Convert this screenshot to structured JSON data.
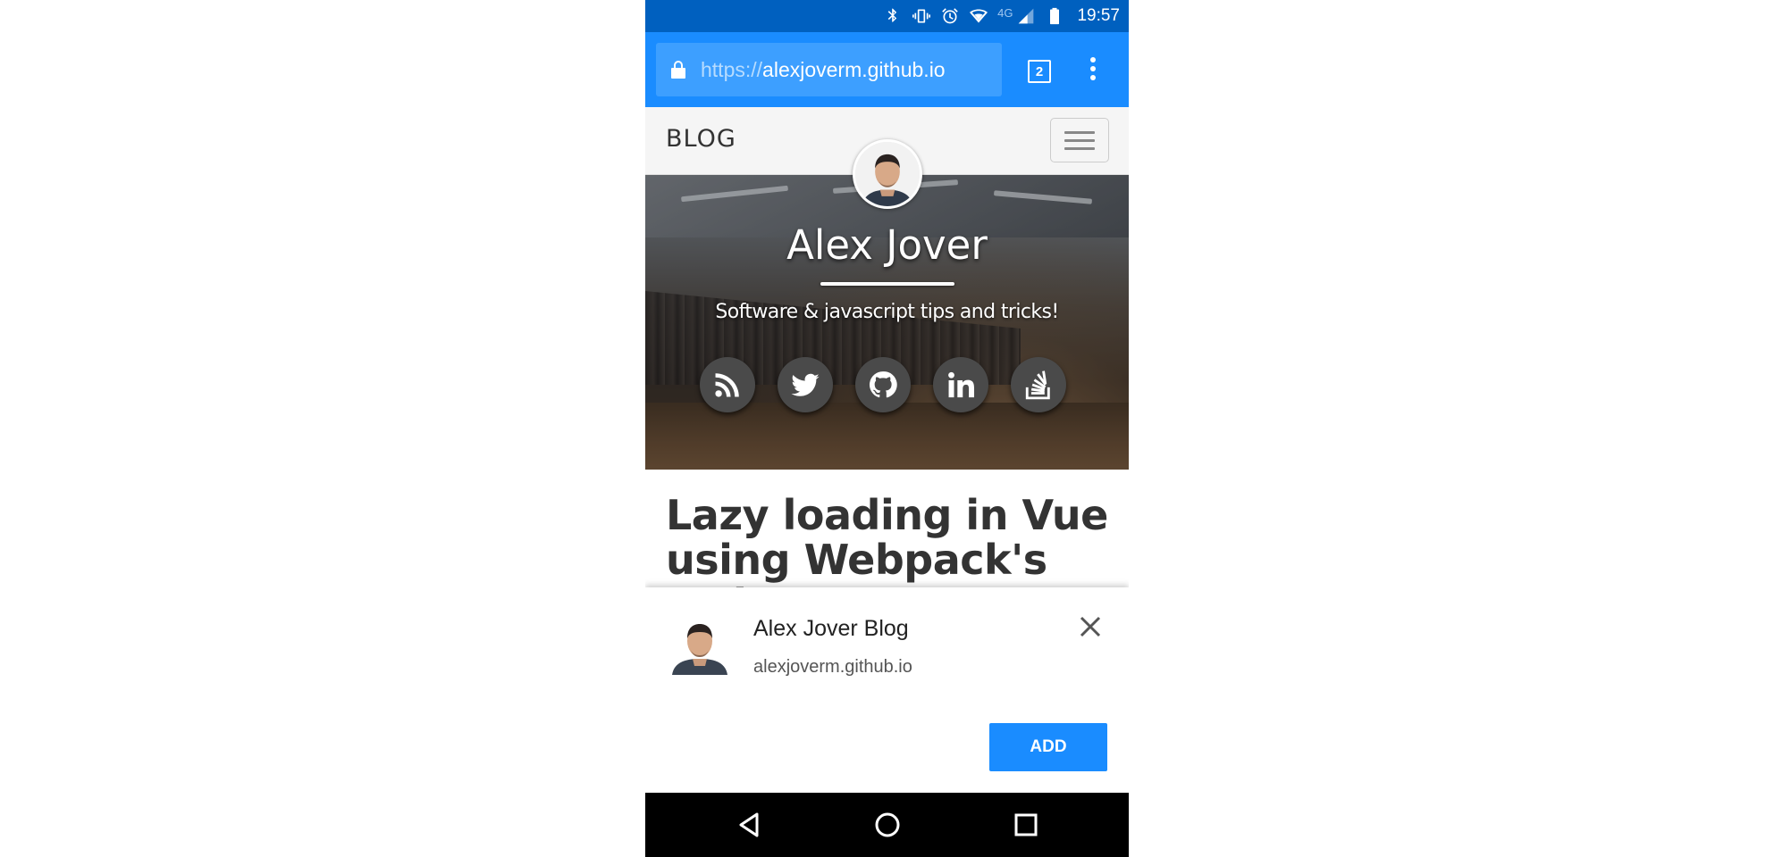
{
  "status_bar": {
    "network_label": "4G",
    "time": "19:57",
    "icons": [
      "bluetooth-icon",
      "vibrate-icon",
      "alarm-icon",
      "wifi-icon",
      "signal-icon",
      "battery-icon"
    ]
  },
  "browser": {
    "url_scheme": "https://",
    "url_host": "alexjoverm.github.io",
    "tab_count": "2",
    "accent_color": "#1a8cff",
    "status_color": "#0060bf"
  },
  "site": {
    "brand": "BLOG",
    "header_title": "Alex Jover",
    "header_subtitle": "Software & javascript tips and tricks!",
    "social_links": [
      {
        "name": "rss-icon"
      },
      {
        "name": "twitter-icon"
      },
      {
        "name": "github-icon"
      },
      {
        "name": "linkedin-icon"
      },
      {
        "name": "stackoverflow-icon"
      }
    ],
    "article_title": "Lazy loading in Vue using Webpack's code"
  },
  "install_banner": {
    "app_name": "Alex Jover Blog",
    "app_url": "alexjoverm.github.io",
    "add_label": "ADD"
  },
  "system_nav": {
    "icons": [
      "back-icon",
      "home-icon",
      "recents-icon"
    ]
  }
}
